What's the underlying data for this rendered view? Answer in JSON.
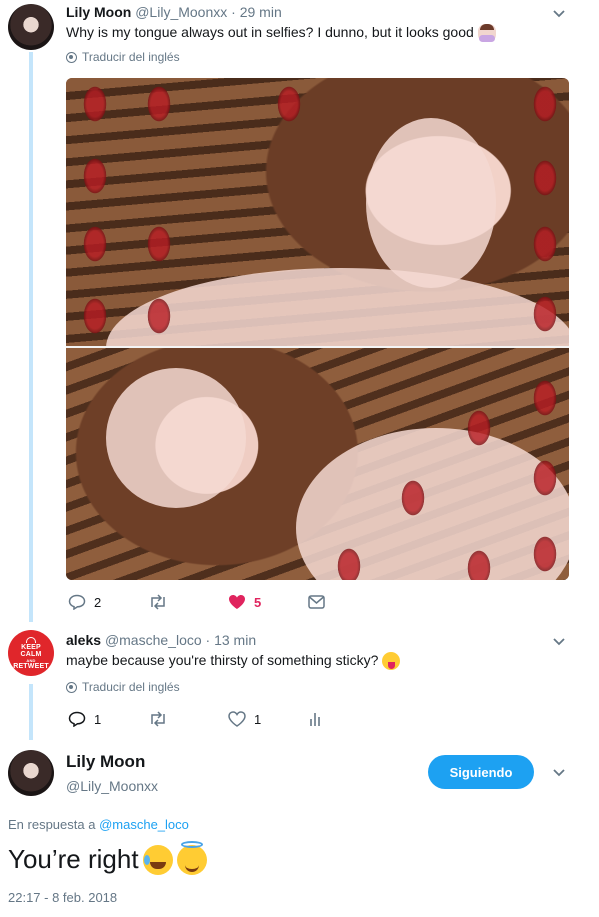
{
  "tweet1": {
    "name": "Lily Moon",
    "handle": "@Lily_Moonxx",
    "separator": "·",
    "time": "29 min",
    "text": "Why is my tongue always out in selfies? I dunno, but it looks good",
    "emoji": "woman-shrugging-emoji",
    "translate": "Traducir del inglés",
    "actions": {
      "reply_count": "2",
      "retweet_count": "",
      "like_count": "5",
      "like_color": "#e0245e"
    }
  },
  "tweet2": {
    "name": "aleks",
    "handle": "@masche_loco",
    "separator": "·",
    "time": "13 min",
    "text": "maybe because you're thirsty of something sticky?",
    "emoji": "tongue-out-emoji",
    "avatar_text": [
      "KEEP",
      "CALM",
      "AND",
      "RETWEET"
    ],
    "translate": "Traducir del inglés",
    "actions": {
      "reply_count": "1",
      "retweet_count": "",
      "like_count": "1"
    }
  },
  "main_tweet": {
    "name": "Lily Moon",
    "handle": "@Lily_Moonxx",
    "follow_label": "Siguiendo",
    "reply_prefix": "En respuesta a",
    "reply_handle": "@masche_loco",
    "text": "You’re right",
    "emojis": [
      "tears-of-joy-emoji",
      "smiling-halo-emoji"
    ],
    "timestamp": "22:17 - 8 feb. 2018"
  },
  "colors": {
    "accent": "#1da1f2",
    "thread_line": "#c4e5fb",
    "secondary_text": "#657786",
    "like": "#e0245e"
  }
}
